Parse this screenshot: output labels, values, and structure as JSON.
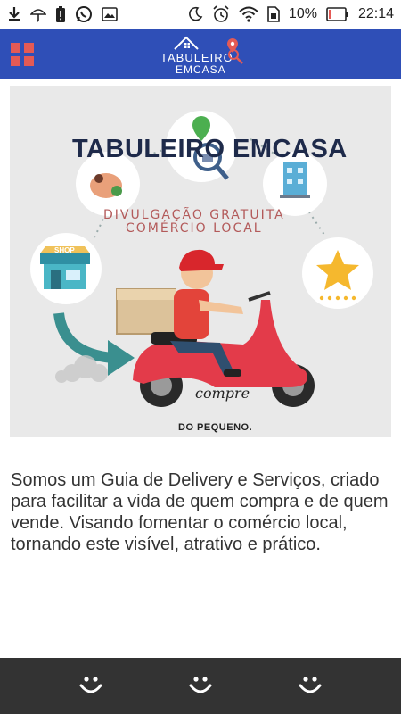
{
  "statusbar": {
    "battery_percent": "10%",
    "time": "22:14",
    "icons_left": [
      "download-icon",
      "umbrella-icon",
      "battery-alert-icon",
      "whatsapp-icon",
      "image-icon"
    ],
    "icons_right": [
      "moon-icon",
      "alarm-icon",
      "wifi-icon",
      "sim-icon",
      "battery-icon"
    ]
  },
  "appbar": {
    "menu_icon": "grid-menu-icon",
    "brand_line1": "TABULEIRO",
    "brand_line2": "EMCASA"
  },
  "banner": {
    "title": "TABULEIRO EMCASA",
    "subtitle_line1": "DIVULGAÇÃO GRATUITA",
    "subtitle_line2": "COMÉRCIO LOCAL",
    "shop_sign": "SHOP",
    "script_text": "compre",
    "footer": "DO PEQUENO."
  },
  "description": "Somos um Guia de Delivery e Serviços, criado para facilitar a vida de quem compra e de quem vende. Visando fomentar o comércio local, tornando este visível, atrativo e prático.",
  "bottom_nav": {
    "icons": [
      "smiley-icon",
      "smiley-icon",
      "smiley-icon"
    ]
  },
  "colors": {
    "appbar": "#2f4fb7",
    "accent_red": "#e45a55",
    "bottom_nav": "#333333",
    "scooter": "#e33b4a"
  }
}
